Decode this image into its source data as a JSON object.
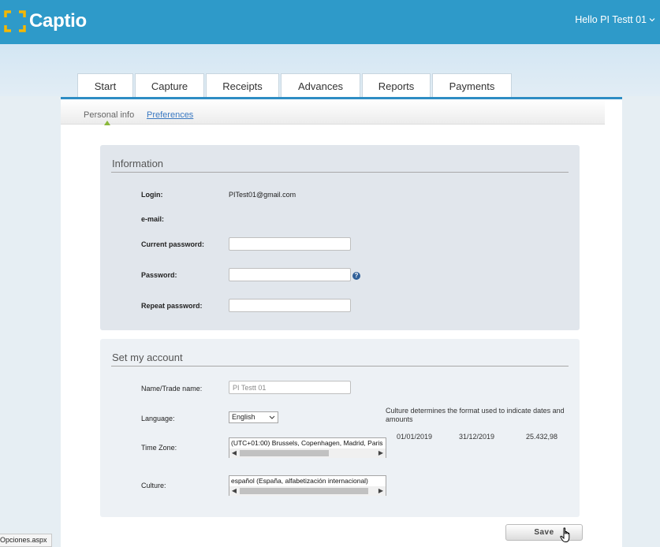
{
  "header": {
    "logo_text": "Captio",
    "greeting": "Hello PI Testt 01"
  },
  "tabs": [
    {
      "label": "Start"
    },
    {
      "label": "Capture"
    },
    {
      "label": "Receipts"
    },
    {
      "label": "Advances"
    },
    {
      "label": "Reports"
    },
    {
      "label": "Payments"
    }
  ],
  "subnav": {
    "personal_info": "Personal info",
    "preferences": "Preferences"
  },
  "information": {
    "title": "Information",
    "login_label": "Login:",
    "login_value": "PITest01@gmail.com",
    "email_label": "e-mail:",
    "current_password_label": "Current password:",
    "password_label": "Password:",
    "repeat_password_label": "Repeat password:",
    "help_glyph": "?"
  },
  "account": {
    "title": "Set my account",
    "name_label": "Name/Trade name:",
    "name_placeholder": "PI Testt 01",
    "language_label": "Language:",
    "language_value": "English",
    "timezone_label": "Time Zone:",
    "timezone_value": "(UTC+01:00) Brussels, Copenhagen, Madrid, Paris",
    "culture_label": "Culture:",
    "culture_value": "español (España, alfabetización internacional)",
    "culture_note": "Culture determines the format used to indicate dates and amounts",
    "sample_date_1": "01/01/2019",
    "sample_date_2": "31/12/2019",
    "sample_amount": "25.432,98"
  },
  "actions": {
    "save_label": "Save"
  },
  "statusbar": {
    "text": "Opciones.aspx"
  },
  "colors": {
    "header_blue": "#2e9ac9",
    "logo_yellow": "#f5b800",
    "active_marker": "#8ab83a",
    "link_blue": "#3a79c2"
  }
}
